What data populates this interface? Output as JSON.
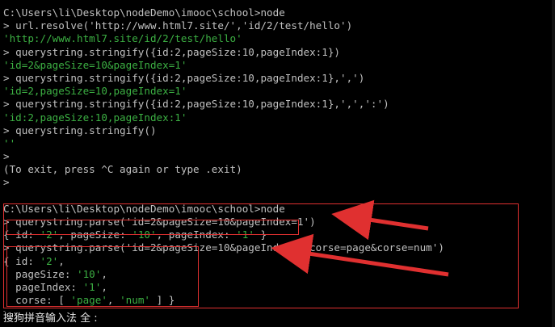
{
  "window_title": "",
  "terminal": {
    "prompt_prefix": "> ",
    "lines": [
      [
        {
          "t": "C:\\Users\\li\\Desktop\\nodeDemo\\imooc\\school>node",
          "c": "w"
        }
      ],
      [
        {
          "t": "> url.resolve('http://www.html7.site/','id/2/test/hello')",
          "c": "w"
        }
      ],
      [
        {
          "t": "'http://www.html7.site/id/2/test/hello'",
          "c": "g"
        }
      ],
      [
        {
          "t": "> querystring.stringify({id:2,pageSize:10,pageIndex:1})",
          "c": "w"
        }
      ],
      [
        {
          "t": "'id=2&pageSize=10&pageIndex=1'",
          "c": "g"
        }
      ],
      [
        {
          "t": "> querystring.stringify({id:2,pageSize:10,pageIndex:1},',')",
          "c": "w"
        }
      ],
      [
        {
          "t": "'id=2,pageSize=10,pageIndex=1'",
          "c": "g"
        }
      ],
      [
        {
          "t": "> querystring.stringify({id:2,pageSize:10,pageIndex:1},',',':')",
          "c": "w"
        }
      ],
      [
        {
          "t": "'id:2,pageSize:10,pageIndex:1'",
          "c": "g"
        }
      ],
      [
        {
          "t": "> querystring.stringify()",
          "c": "w"
        }
      ],
      [
        {
          "t": "''",
          "c": "g"
        }
      ],
      [
        {
          "t": ">",
          "c": "w"
        }
      ],
      [
        {
          "t": "(To exit, press ^C again or type .exit)",
          "c": "w"
        }
      ],
      [
        {
          "t": ">",
          "c": "w"
        }
      ],
      [
        {
          "t": "",
          "c": "w"
        }
      ],
      [
        {
          "t": "C:\\Users\\li\\Desktop\\nodeDemo\\imooc\\school>node",
          "c": "w"
        }
      ],
      [
        {
          "t": "> querystring.parse('id=2&pageSize=10&pageIndex=1')",
          "c": "w"
        }
      ],
      [
        {
          "t": "{ id: ",
          "c": "w"
        },
        {
          "t": "'2'",
          "c": "g"
        },
        {
          "t": ", pageSize: ",
          "c": "w"
        },
        {
          "t": "'10'",
          "c": "g"
        },
        {
          "t": ", pageIndex: ",
          "c": "w"
        },
        {
          "t": "'1'",
          "c": "g"
        },
        {
          "t": " }",
          "c": "w"
        }
      ],
      [
        {
          "t": "> querystring.parse('id=2&pageSize=10&pageIndex=1&corse=page&corse=num')",
          "c": "w"
        }
      ],
      [
        {
          "t": "{ id: ",
          "c": "w"
        },
        {
          "t": "'2'",
          "c": "g"
        },
        {
          "t": ",",
          "c": "w"
        }
      ],
      [
        {
          "t": "  pageSize: ",
          "c": "w"
        },
        {
          "t": "'10'",
          "c": "g"
        },
        {
          "t": ",",
          "c": "w"
        }
      ],
      [
        {
          "t": "  pageIndex: ",
          "c": "w"
        },
        {
          "t": "'1'",
          "c": "g"
        },
        {
          "t": ",",
          "c": "w"
        }
      ],
      [
        {
          "t": "  corse: [ ",
          "c": "w"
        },
        {
          "t": "'page'",
          "c": "g"
        },
        {
          "t": ", ",
          "c": "w"
        },
        {
          "t": "'num'",
          "c": "g"
        },
        {
          "t": " ] }",
          "c": "w"
        }
      ],
      [
        {
          "t": ">",
          "c": "w"
        }
      ]
    ]
  },
  "ime_status": "搜狗拼音输入法 全 :",
  "colors": {
    "background": "#000000",
    "text": "#c0c0c0",
    "string": "#3cb043",
    "annotation": "#e03030"
  }
}
